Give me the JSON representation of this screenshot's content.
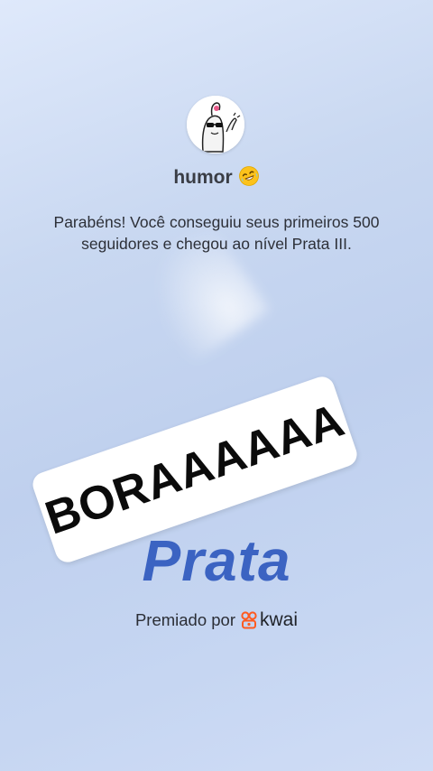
{
  "profile": {
    "username": "humor",
    "emoji": "rolling-on-floor-laughing-emoji",
    "avatar": "meme-character-avatar"
  },
  "message": "Parabéns! Você conseguiu seus primeiros 500 seguidores e chegou ao nível Prata III.",
  "stamp_text": "BORAAAAAA",
  "level_label": "Prata",
  "footer": {
    "awarded_by": "Premiado por",
    "brand_name": "kwai",
    "brand_color": "#ff5a1f"
  },
  "colors": {
    "level_blue": "#3b63c2",
    "background": "#c9d8f1"
  }
}
